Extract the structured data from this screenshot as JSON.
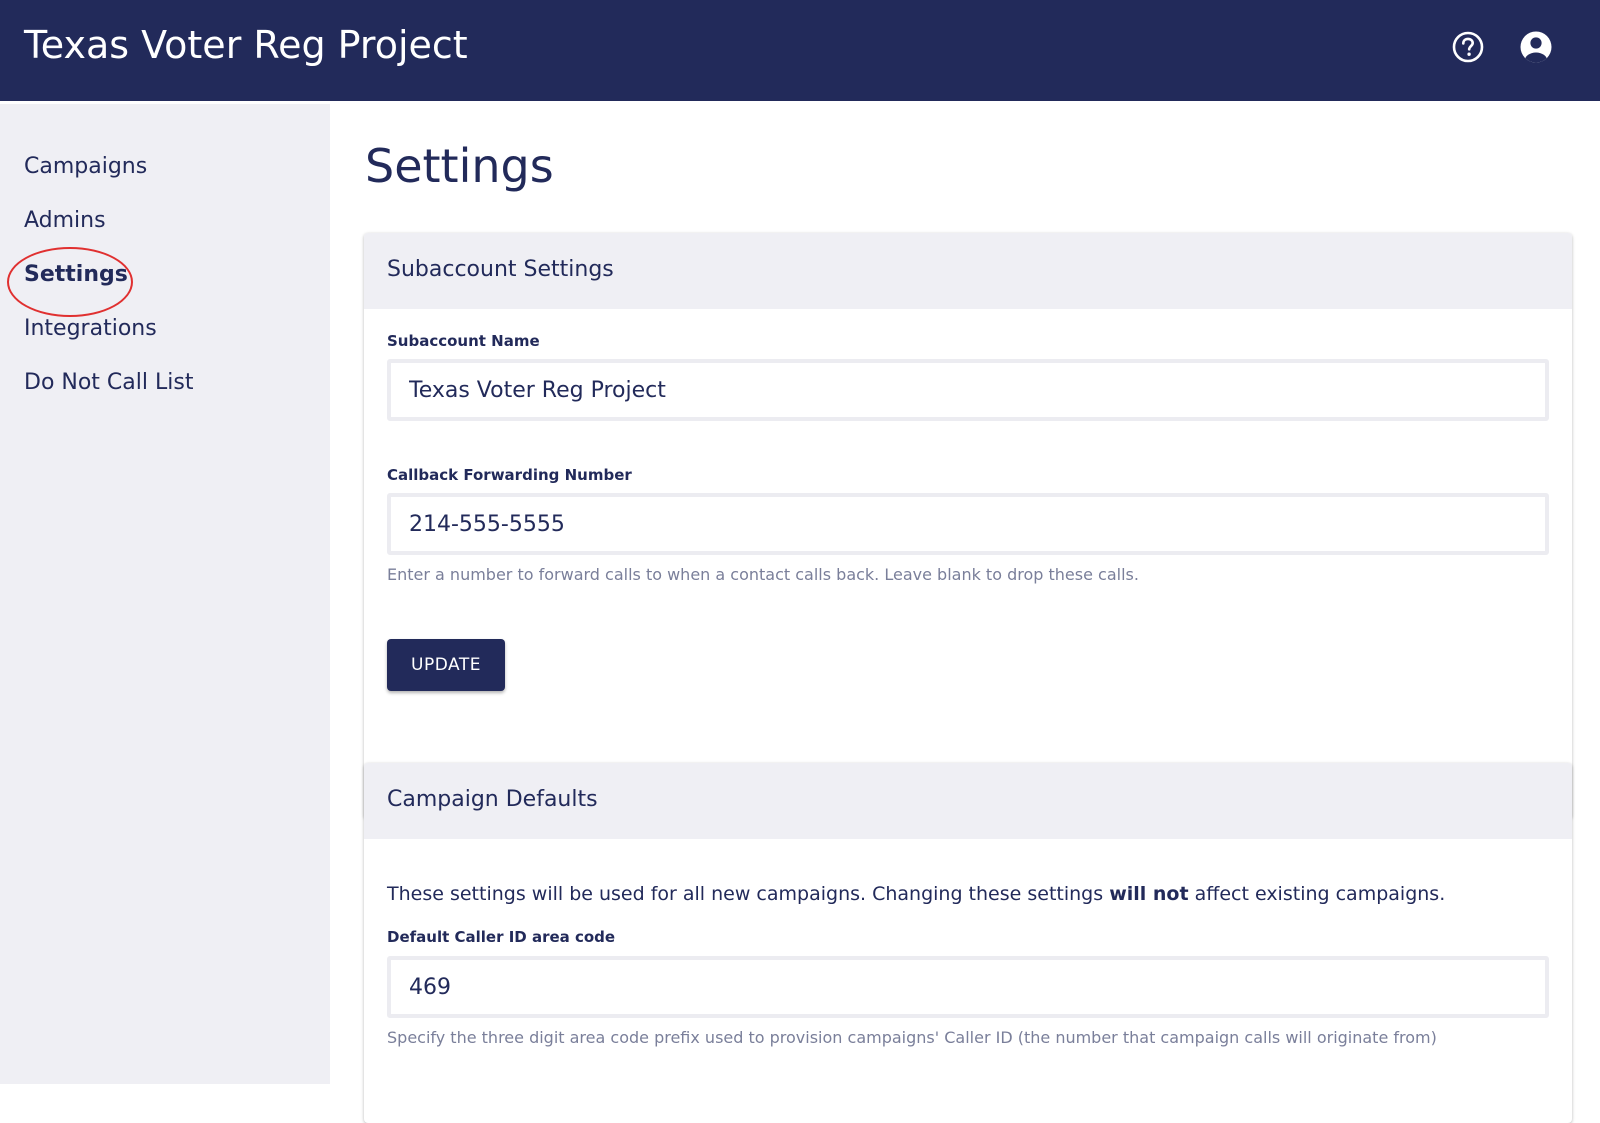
{
  "header": {
    "app_title": "Texas Voter Reg Project",
    "help_icon": "help-circle-icon",
    "account_icon": "account-circle-icon"
  },
  "sidebar": {
    "items": [
      {
        "label": "Campaigns"
      },
      {
        "label": "Admins"
      },
      {
        "label": "Settings",
        "active": true
      },
      {
        "label": "Integrations"
      },
      {
        "label": "Do Not Call List"
      }
    ],
    "highlight_color": "#e03030"
  },
  "main": {
    "page_title": "Settings",
    "subaccount_settings": {
      "header": "Subaccount Settings",
      "name_label": "Subaccount Name",
      "name_value": "Texas Voter Reg Project",
      "callback_label": "Callback Forwarding Number",
      "callback_value": "214-555-5555",
      "callback_help": "Enter a number to forward calls to when a contact calls back. Leave blank to drop these calls.",
      "update_label": "UPDATE"
    },
    "campaign_defaults": {
      "header": "Campaign Defaults",
      "intro_before": "These settings will be used for all new campaigns. Changing these settings ",
      "intro_bold": "will not",
      "intro_after": " affect existing campaigns.",
      "area_code_label": "Default Caller ID area code",
      "area_code_value": "469",
      "area_code_help": "Specify the three digit area code prefix used to provision campaigns' Caller ID (the number that campaign calls will originate from)"
    }
  },
  "colors": {
    "primary": "#222a5a",
    "sidebar_bg": "#efeff4",
    "card_header_bg": "#efeff4",
    "help_text": "#7a7f9a"
  }
}
